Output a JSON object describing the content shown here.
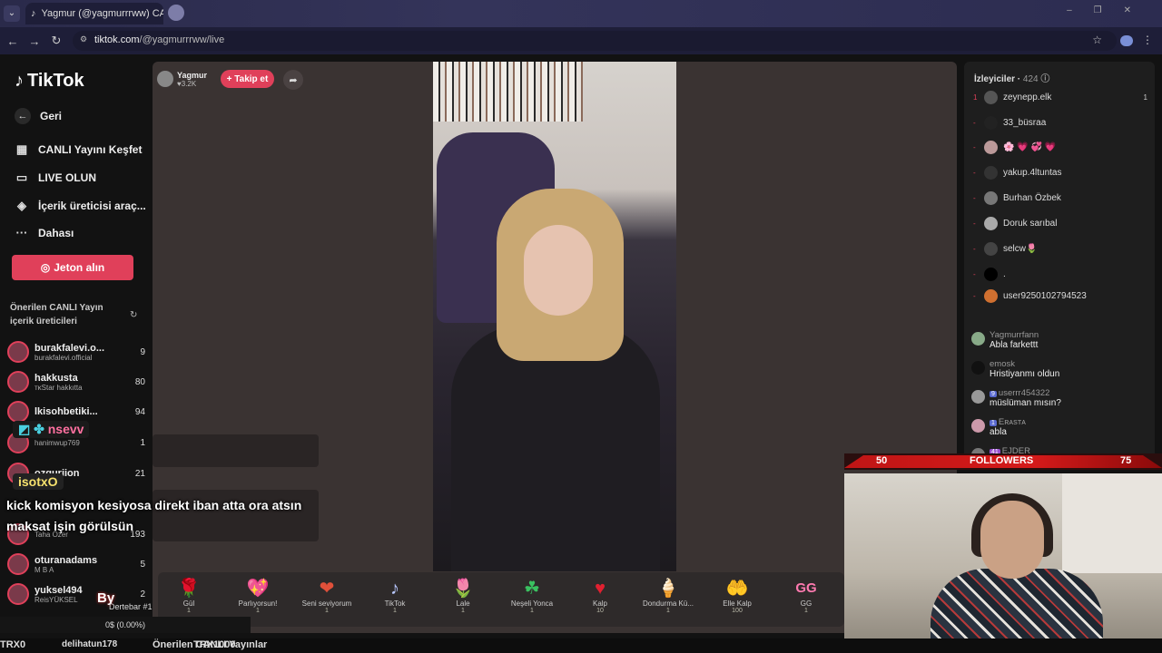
{
  "browser": {
    "tab_title": "Yagmur (@yagmurrrww) CANL",
    "url_host": "tiktok.com",
    "url_path": "/@yagmurrrww/live"
  },
  "sidebar": {
    "logo": "TikTok",
    "nav": [
      {
        "label": "Geri",
        "icon": "arrow-left-icon"
      },
      {
        "label": "CANLI Yayını Keşfet",
        "icon": "calendar-icon"
      },
      {
        "label": "LIVE OLUN",
        "icon": "video-camera-icon"
      },
      {
        "label": "İçerik üreticisi araç...",
        "icon": "lightbulb-icon"
      },
      {
        "label": "Dahası",
        "icon": "more-icon"
      }
    ],
    "coin_button": "Jeton alın",
    "suggested_title": "Önerilen CANLI Yayın içerik üreticileri",
    "creators": [
      {
        "name": "burakfalevi.o...",
        "sub": "burakfalevi.official",
        "count": "9"
      },
      {
        "name": "hakkusta",
        "sub": "ᴛᴋStar hakkıtta",
        "count": "80"
      },
      {
        "name": "lkisohbetiki...",
        "sub": "",
        "count": "94"
      },
      {
        "name": "",
        "sub": "hanimwup769",
        "count": "1"
      },
      {
        "name": "ozguriion",
        "sub": "",
        "count": "21"
      },
      {
        "name": "",
        "sub": "Taha Özer",
        "count": "193"
      },
      {
        "name": "oturanadams",
        "sub": "M B A",
        "count": "5"
      },
      {
        "name": "yuksel494",
        "sub": "ReisYÜKSEL",
        "count": "2"
      }
    ],
    "bottom_link": "delihatun178",
    "bottom_title": "Önerilen CANLI Yayınlar"
  },
  "stream": {
    "host_name": "Yagmur",
    "host_likes": "3.2K",
    "follow_label": "+ Takip et"
  },
  "gifts": [
    {
      "name": "Gül",
      "price": "1",
      "icon": "rose-icon",
      "glyph": "🌹"
    },
    {
      "name": "Parlıyorsun!",
      "price": "1",
      "icon": "heart-card-icon",
      "glyph": "💖"
    },
    {
      "name": "Seni seviyorum",
      "price": "1",
      "icon": "love-icon",
      "glyph": "❤"
    },
    {
      "name": "TikTok",
      "price": "1",
      "icon": "tiktok-icon",
      "glyph": "♪"
    },
    {
      "name": "Lale",
      "price": "1",
      "icon": "tulip-icon",
      "glyph": "🌷"
    },
    {
      "name": "Neşeli Yonca",
      "price": "1",
      "icon": "clover-icon",
      "glyph": "☘"
    },
    {
      "name": "Kalp",
      "price": "10",
      "icon": "heart-icon",
      "glyph": "♥"
    },
    {
      "name": "Dondurma Kü...",
      "price": "1",
      "icon": "ice-cream-icon",
      "glyph": "🍦"
    },
    {
      "name": "Elle Kalp",
      "price": "100",
      "icon": "hand-heart-icon",
      "glyph": "🤲"
    },
    {
      "name": "GG",
      "price": "1",
      "icon": "gg-icon",
      "glyph": "GG"
    }
  ],
  "viewers_panel": {
    "title": "İzleyiciler",
    "count": "424",
    "viewers": [
      {
        "rank": "1",
        "name": "zeynepp.elk",
        "right": "1"
      },
      {
        "rank": "-",
        "name": "33_büsraa",
        "right": ""
      },
      {
        "rank": "-",
        "name": "🌸 💗 💞 💗",
        "right": ""
      },
      {
        "rank": "-",
        "name": "yakup.4ltuntas",
        "right": ""
      },
      {
        "rank": "-",
        "name": "Burhan Özbek",
        "right": ""
      },
      {
        "rank": "-",
        "name": "Doruk sarıbal",
        "right": ""
      },
      {
        "rank": "-",
        "name": "selcw🌷",
        "right": ""
      },
      {
        "rank": "-",
        "name": ".",
        "right": ""
      },
      {
        "rank": "-",
        "name": "user9250102794523",
        "right": ""
      }
    ],
    "chat": [
      {
        "user": "Yagmurrfann",
        "badge": "",
        "msg": "Abla farkettt"
      },
      {
        "user": "emosk",
        "badge": "",
        "msg": "Hristiyanmı oldun"
      },
      {
        "user": "userrr454322",
        "badge": "9",
        "msg": "müslüman mısın?"
      },
      {
        "user": "Eʀᴀsᴛᴀ",
        "badge": "1",
        "msg": "abla"
      },
      {
        "user": "EJDER",
        "badge": "41",
        "msg": ""
      }
    ]
  },
  "overlay": {
    "followers_left": "50",
    "followers_label": "FOLLOWERS",
    "followers_right": "75",
    "tag_nsevv": "nsevv",
    "tag_isotx": "isotxO",
    "caption": "kick komisyon kesiyosa direkt iban atta ora atsın maksat işin görülsün",
    "stats": "0$ (0.00%)",
    "bottom_left": "TRX0",
    "bottom_mid": "TRX1000",
    "by_tag": "By",
    "debate": "Dertebar #1"
  }
}
